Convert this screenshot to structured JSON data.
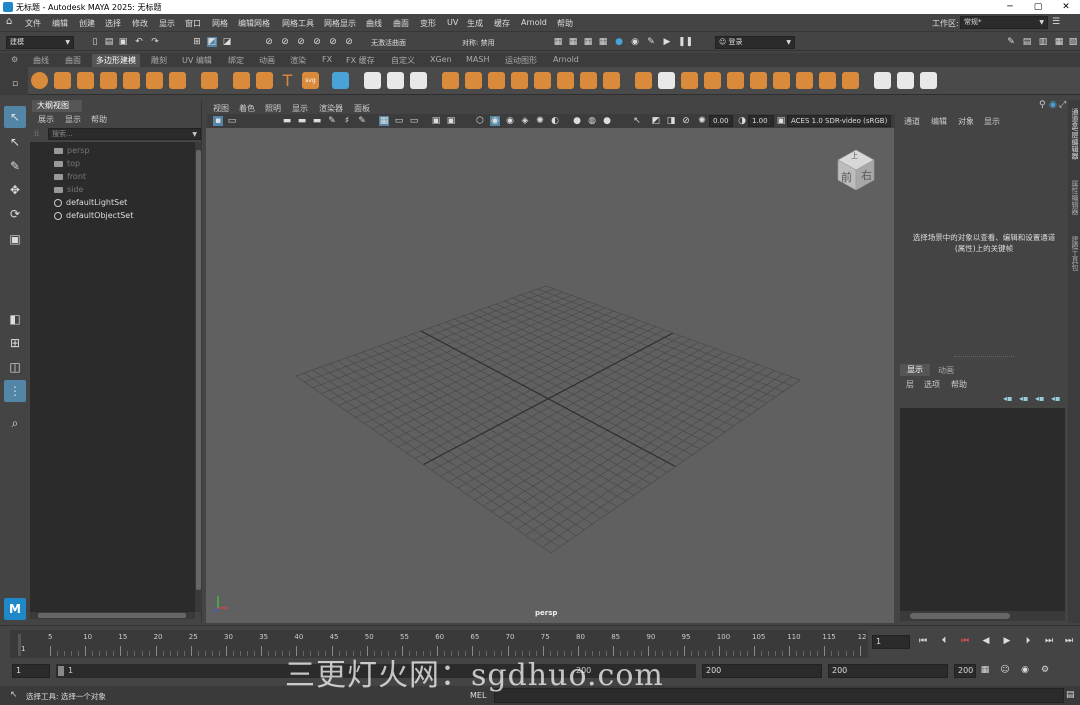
{
  "window": {
    "title": "无标题 - Autodesk MAYA 2025: 无标题"
  },
  "menubar": {
    "items": [
      "文件",
      "编辑",
      "创建",
      "选择",
      "修改",
      "显示",
      "窗口",
      "网格",
      "编辑网格",
      "网格工具",
      "网格显示",
      "曲线",
      "曲面",
      "变形",
      "UV",
      "生成",
      "缓存",
      "Arnold",
      "帮助"
    ],
    "workspace_label": "工作区:",
    "workspace_value": "常规*"
  },
  "statusline": {
    "mode": "建模",
    "live_surface": "无激活曲面",
    "symmetry": "对称: 禁用",
    "login": "登录"
  },
  "shelf": {
    "tabs": [
      "曲线",
      "曲面",
      "多边形建模",
      "雕刻",
      "UV 编辑",
      "绑定",
      "动画",
      "渲染",
      "FX",
      "FX 缓存",
      "自定义",
      "XGen",
      "MASH",
      "运动图形",
      "Arnold"
    ],
    "active_tab": 2
  },
  "outliner": {
    "title": "大纲视图",
    "menu": [
      "展示",
      "显示",
      "帮助"
    ],
    "search_placeholder": "搜索...",
    "items": [
      {
        "label": "persp",
        "kind": "camera"
      },
      {
        "label": "top",
        "kind": "camera"
      },
      {
        "label": "front",
        "kind": "camera"
      },
      {
        "label": "side",
        "kind": "camera"
      },
      {
        "label": "defaultLightSet",
        "kind": "set"
      },
      {
        "label": "defaultObjectSet",
        "kind": "set"
      }
    ]
  },
  "viewport": {
    "menu": [
      "视图",
      "着色",
      "照明",
      "显示",
      "渲染器",
      "面板"
    ],
    "exposure": "0.00",
    "gamma": "1.00",
    "color_space": "ACES 1.0 SDR-video (sRGB)",
    "camera_label": "persp",
    "viewcube_front": "前",
    "viewcube_right": "右",
    "viewcube_top": "上"
  },
  "channelbox": {
    "menu": [
      "通道",
      "编辑",
      "对象",
      "显示"
    ],
    "message": "选择场景中的对象以查看、编辑和设置通道(属性)上的关键帧",
    "side_tabs": [
      "通道盒/层编辑器",
      "属性编辑器",
      "建模工具包"
    ]
  },
  "layers": {
    "tabs": [
      "显示",
      "动画"
    ],
    "menu": [
      "层",
      "选项",
      "帮助"
    ]
  },
  "timeline": {
    "ticks": [
      "5",
      "10",
      "15",
      "20",
      "25",
      "30",
      "35",
      "40",
      "45",
      "50",
      "55",
      "60",
      "65",
      "70",
      "75",
      "80",
      "85",
      "90",
      "95",
      "100",
      "105",
      "110",
      "115",
      "12"
    ],
    "start_marker": "1",
    "current_frame": "1"
  },
  "range": {
    "start": "1",
    "inner_start": "1",
    "inner_end": "200",
    "end": "200",
    "end2": "200",
    "end3": "200"
  },
  "commandline": {
    "status": "选择工具: 选择一个对象",
    "lang": "MEL"
  },
  "watermark": "三更灯火网：sgdhuo.com"
}
